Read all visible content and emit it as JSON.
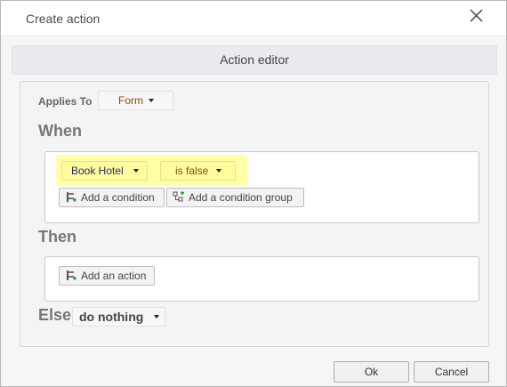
{
  "dialog": {
    "title": "Create action",
    "close_icon": "close-icon"
  },
  "editor": {
    "header": "Action editor",
    "applies_to": {
      "label": "Applies To",
      "value": "Form"
    },
    "when": {
      "label": "When",
      "condition": {
        "field": "Book Hotel",
        "operator": "is false",
        "highlight_color": "#ffffa8"
      },
      "add_condition_label": "Add a condition",
      "add_condition_group_label": "Add a condition group"
    },
    "then": {
      "label": "Then",
      "add_action_label": "Add an action"
    },
    "else": {
      "label": "Else",
      "value": "do nothing"
    }
  },
  "footer": {
    "ok_label": "Ok",
    "cancel_label": "Cancel"
  }
}
